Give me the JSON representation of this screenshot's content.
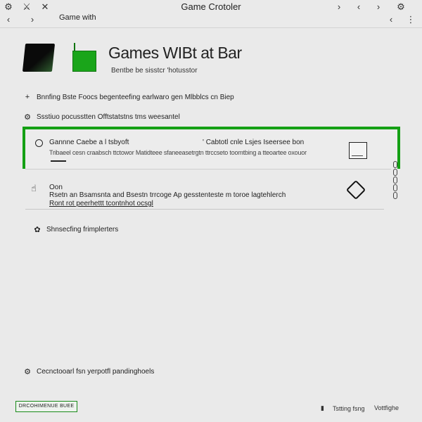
{
  "window": {
    "title": "Game Crotoler",
    "subtitle": "Game with",
    "icons": {
      "top_left": [
        "settings-gear-icon",
        "pin-icon",
        "close-x-icon"
      ],
      "nav_left": [
        "back-chevron-icon",
        "forward-chevron-icon"
      ],
      "top_right": [
        "chevron-right-icon",
        "chevron-left-icon",
        "chevron-right-icon",
        "settings-gear-icon"
      ],
      "nav_right": [
        "chevron-left-icon",
        "more-vertical-icon"
      ]
    }
  },
  "header": {
    "title": "Games WIBt at Bar",
    "subtitle": "Bentbe be sisstcr 'hotusstor"
  },
  "lines": [
    {
      "icon": "plus-icon",
      "text": "Bnnfing Bste Foocs begenteefing earlwaro gen Mlbblcs cn Biep"
    },
    {
      "icon": "gear-icon",
      "text": "Ssstiuo pocusstten Offtstatstns tms weesantel"
    }
  ],
  "card_green": {
    "icon": "circle-icon",
    "title": "Gannne Caebe a l tsbyoft",
    "right_title": "' Cabtotl cnle Lsjes Iseersee bon",
    "desc": "Tribaeel cesn craabsch ttctowor Matidteee sfaneeasetrgtn ttrccseto toomtbing a tteoartee oxouor"
  },
  "card_2": {
    "icon": "cursor-hand-icon",
    "label": "Oon",
    "desc": "Rsetn an Bsamsnta and Bsestn trrcoge Ap gesstenteste m toroe lagtehlerch",
    "link": "Ront rot peerhettt tcontnhot ocsgl"
  },
  "line_item_3": {
    "icon": "flower-icon",
    "text": "Shnsecfing frimplerters"
  },
  "line_item_4": {
    "icon": "gear-icon",
    "text": "Cecnctooarl fsn yerpotfl pandinghoels"
  },
  "footer": {
    "button_label": "DRCOHIMENUE BUEE",
    "right_1": "Tstting fsng",
    "right_2": "Vottfighe"
  }
}
